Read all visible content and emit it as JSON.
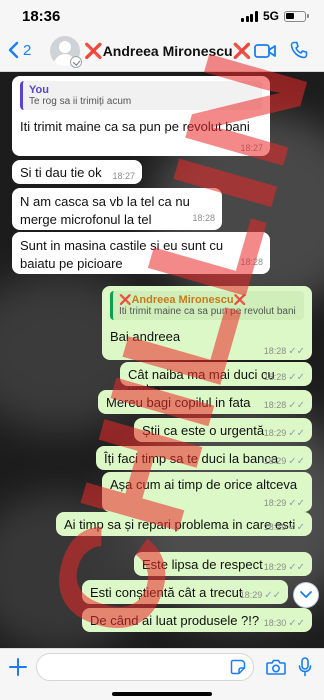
{
  "status_bar": {
    "time": "18:36",
    "network": "5G"
  },
  "header": {
    "back_count": "2",
    "contact_name": "Andreea Mironescu",
    "mark": "❌"
  },
  "watermark": "CHILLIN",
  "messages": [
    {
      "dir": "in",
      "quote_author": "You",
      "quote_text": "Te rog sa ii trimiți acum",
      "text": "Iti trimit maine ca sa pun pe revolut bani",
      "time": "18:27"
    },
    {
      "dir": "in",
      "text": "Si ti dau tie ok",
      "time": "18:27"
    },
    {
      "dir": "in",
      "text": "N am casca sa vb la tel ca nu merge microfonul la tel",
      "time": "18:28"
    },
    {
      "dir": "in",
      "text": "Sunt in masina castile si eu sunt cu baiatu pe picioare",
      "time": "18:28"
    },
    {
      "dir": "out",
      "quote_author": "Andreea Mironescu",
      "quote_text": "Iti trimit maine ca sa pun pe revolut bani",
      "text": "Bai andreea",
      "time": "18:28"
    },
    {
      "dir": "out",
      "text": "Cât naiba ma mai duci cu vorba",
      "time": "18:28"
    },
    {
      "dir": "out",
      "text": "Mereu bagi copilul in fata",
      "time": "18:28"
    },
    {
      "dir": "out",
      "text": "Știi ca este o urgentă",
      "time": "18:29"
    },
    {
      "dir": "out",
      "text": "Îți faci timp sa te duci la banca",
      "time": "18:29"
    },
    {
      "dir": "out",
      "text": "Așa cum ai timp de orice altceva",
      "time": "18:29"
    },
    {
      "dir": "out",
      "text": "Ai timp sa și repari problema in care esti",
      "time": "18:29"
    },
    {
      "dir": "out",
      "text": "Este lipsa de respect",
      "time": "18:29"
    },
    {
      "dir": "out",
      "text": "Esti conștientă cât a trecut",
      "time": "18:29"
    },
    {
      "dir": "out",
      "text": "De când ai luat produsele ?!?",
      "time": "18:30"
    }
  ],
  "colors": {
    "accent": "#1a7ef0",
    "outgoing": "#dcf8c6",
    "incoming": "#ffffff",
    "watermark": "#eb2828"
  },
  "icons": [
    "chevron-left-icon",
    "video-call-icon",
    "phone-icon",
    "plus-icon",
    "sticker-icon",
    "camera-icon",
    "microphone-icon",
    "chevron-down-icon"
  ]
}
